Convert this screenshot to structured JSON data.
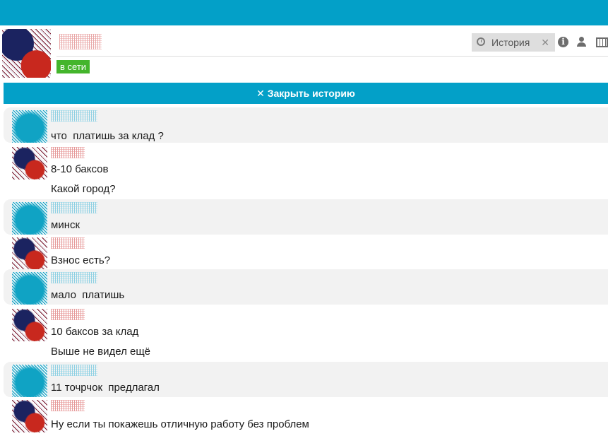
{
  "header": {
    "status": "в сети",
    "history_label": "История",
    "history_close": "✕"
  },
  "history_bar": {
    "label": "✕ Закрыть историю"
  },
  "messages": [
    {
      "author": "me",
      "lines": [
        "что  платишь за клад ?"
      ]
    },
    {
      "author": "other",
      "lines": [
        "8-10 баксов",
        "Какой город?"
      ]
    },
    {
      "author": "me",
      "lines": [
        "минск"
      ]
    },
    {
      "author": "other",
      "lines": [
        "Взнос есть?"
      ]
    },
    {
      "author": "me",
      "lines": [
        "мало  платишь"
      ]
    },
    {
      "author": "other",
      "lines": [
        "10 баксов за клад",
        "Выше не видел ещё"
      ]
    },
    {
      "author": "me",
      "lines": [
        "11 точрчок  предлагал"
      ]
    },
    {
      "author": "other",
      "lines": [
        "Ну если ты покажешь отличную работу без проблем"
      ]
    }
  ],
  "colors": {
    "accent": "#03a0c8",
    "online": "#44b52c",
    "own_message_bg": "#f2f2f2"
  }
}
